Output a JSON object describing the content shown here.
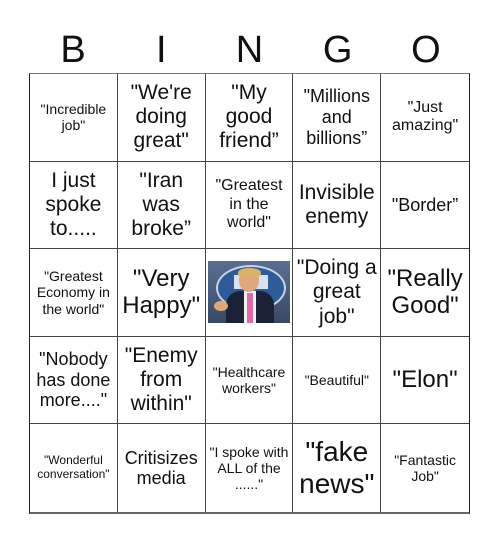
{
  "header": {
    "letters": [
      "B",
      "I",
      "N",
      "G",
      "O"
    ]
  },
  "board": {
    "rows": [
      [
        {
          "text": "\"Incredible job\"",
          "size": "s"
        },
        {
          "text": "\"We're doing great\"",
          "size": "l"
        },
        {
          "text": "\"My good friend”",
          "size": "l"
        },
        {
          "text": "\"Millions and billions”",
          "size": "m"
        },
        {
          "text": "\"Just amazing\"",
          "size": "sm"
        }
      ],
      [
        {
          "text": "I just spoke to.....",
          "size": "l"
        },
        {
          "text": "\"Iran was broke”",
          "size": "l"
        },
        {
          "text": "\"Greatest in the world\"",
          "size": "sm"
        },
        {
          "text": "Invisible enemy",
          "size": "l"
        },
        {
          "text": "\"Border”",
          "size": "m"
        }
      ],
      [
        {
          "text": "\"Greatest Economy in the world\"",
          "size": "s"
        },
        {
          "text": "\"Very Happy\"",
          "size": "xl"
        },
        {
          "text": "",
          "size": "free",
          "image": "president-photo"
        },
        {
          "text": "\"Doing a great job\"",
          "size": "l"
        },
        {
          "text": "\"Really Good\"",
          "size": "xl"
        }
      ],
      [
        {
          "text": "\"Nobody has done more....\"",
          "size": "m"
        },
        {
          "text": "\"Enemy from within\"",
          "size": "l"
        },
        {
          "text": "\"Healthcare workers\"",
          "size": "s"
        },
        {
          "text": "\"Beautiful\"",
          "size": "s"
        },
        {
          "text": "\"Elon\"",
          "size": "xl"
        }
      ],
      [
        {
          "text": "\"Wonderful conversation\"",
          "size": "xs"
        },
        {
          "text": "Critisizes media",
          "size": "m"
        },
        {
          "text": "\"I spoke with ALL of the ......\"",
          "size": "s"
        },
        {
          "text": "\"fake news\"",
          "size": "xxl"
        },
        {
          "text": "\"Fantastic Job\"",
          "size": "s"
        }
      ]
    ]
  }
}
